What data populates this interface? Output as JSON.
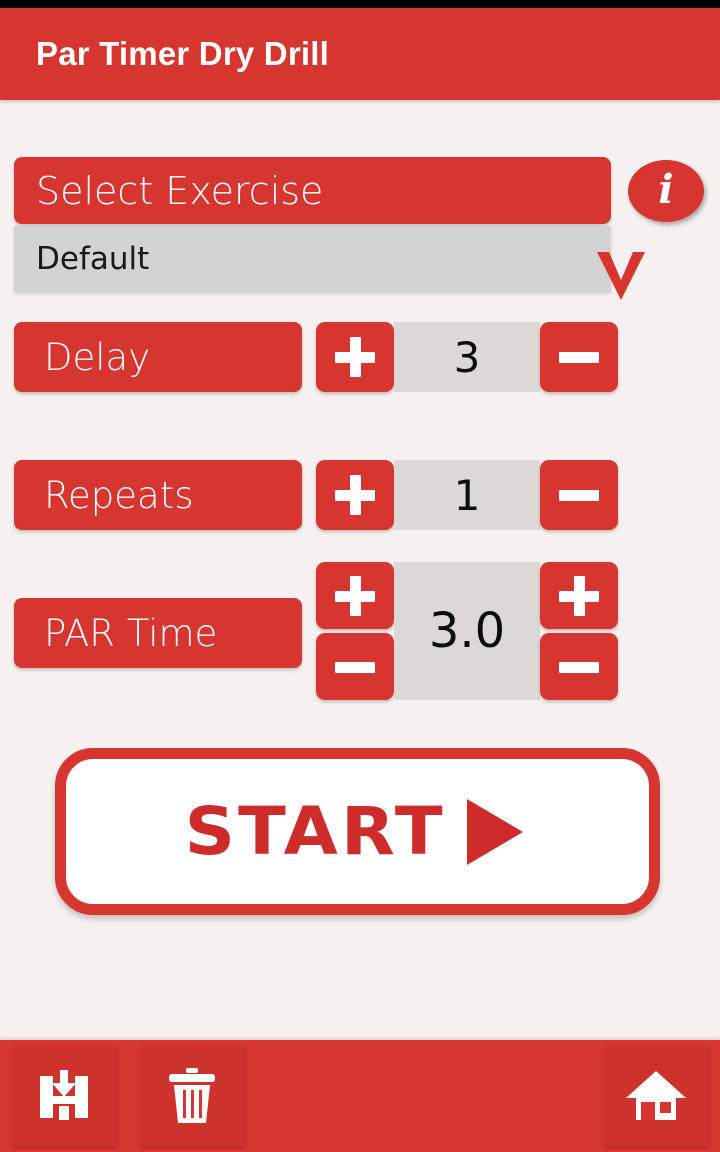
{
  "app": {
    "title": "Par Timer Dry Drill",
    "accent_color": "#D7352F",
    "background_color": "#F7F0F0",
    "value_box_color": "#DDD7D5",
    "dropdown_color": "#D3D3D3"
  },
  "header": {
    "title": "Par Timer Dry Drill"
  },
  "exercise": {
    "section_label": "Select Exercise",
    "info_icon": "info-icon",
    "info_glyph": "i",
    "selected": "Default",
    "chevron_icon": "chevron-down-icon"
  },
  "steppers": [
    {
      "label": "Delay",
      "value": "3",
      "increment_label": "+",
      "decrement_label": "—"
    },
    {
      "label": "Repeats",
      "value": "1",
      "increment_label": "+",
      "decrement_label": "—"
    }
  ],
  "par_time": {
    "label": "PAR Time",
    "value": "3.0",
    "coarse_increment_label": "+",
    "coarse_decrement_label": "—",
    "fine_increment_label": "+",
    "fine_decrement_label": "—"
  },
  "start": {
    "label": "START",
    "play_icon": "play-triangle-icon"
  },
  "toolbar": {
    "save_icon": "save-floppy-icon",
    "delete_icon": "trash-icon",
    "home_icon": "home-icon"
  }
}
